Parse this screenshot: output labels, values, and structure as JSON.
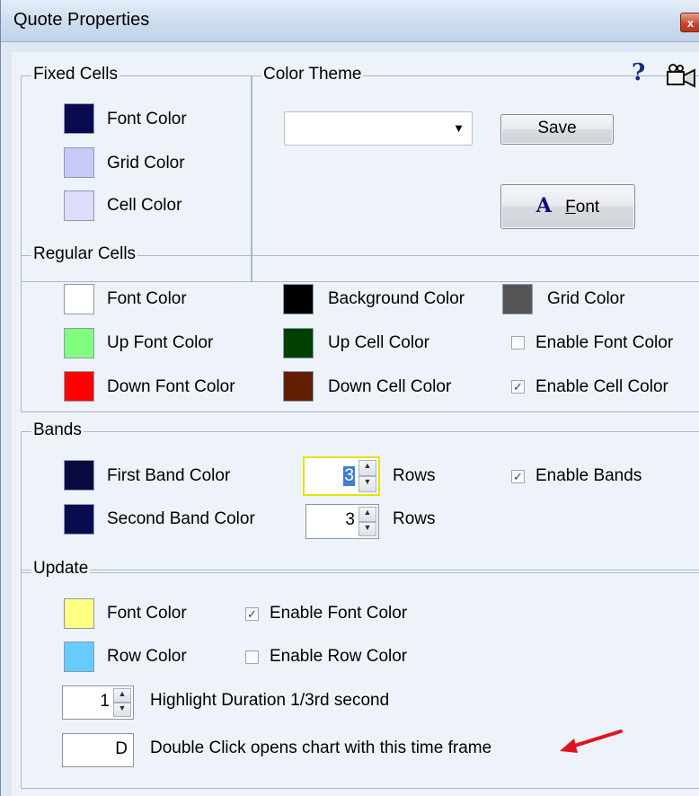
{
  "window": {
    "title": "Quote Properties",
    "close_glyph": "x"
  },
  "fixed_cells": {
    "legend": "Fixed Cells",
    "items": [
      {
        "label": "Font Color",
        "color": "#0a0a50"
      },
      {
        "label": "Grid Color",
        "color": "#c9c9f7"
      },
      {
        "label": "Cell Color",
        "color": "#dcdcfb"
      }
    ]
  },
  "color_theme": {
    "legend": "Color Theme",
    "selected": "",
    "save_label": "Save",
    "font_glyph": "A",
    "font_label": "Font",
    "font_accel": "F"
  },
  "regular_cells": {
    "legend": "Regular Cells",
    "col1": [
      {
        "label": "Font Color",
        "color": "#ffffff"
      },
      {
        "label": "Up Font Color",
        "color": "#80ff80"
      },
      {
        "label": "Down Font Color",
        "color": "#ff0000"
      }
    ],
    "col2": [
      {
        "label": "Background Color",
        "color": "#000000"
      },
      {
        "label": "Up Cell Color",
        "color": "#004000"
      },
      {
        "label": "Down Cell Color",
        "color": "#602000"
      }
    ],
    "grid_color": {
      "label": "Grid Color",
      "color": "#555555"
    },
    "enable_font_color": {
      "label": "Enable Font Color",
      "checked": false
    },
    "enable_cell_color": {
      "label": "Enable Cell Color",
      "checked": true
    }
  },
  "bands": {
    "legend": "Bands",
    "first": {
      "label": "First Band Color",
      "color": "#0a0a40",
      "rows": "3",
      "rows_label": "Rows"
    },
    "second": {
      "label": "Second Band Color",
      "color": "#0a0a50",
      "rows": "3",
      "rows_label": "Rows"
    },
    "enable_bands": {
      "label": "Enable Bands",
      "checked": true
    }
  },
  "update": {
    "legend": "Update",
    "font": {
      "label": "Font Color",
      "color": "#ffff80"
    },
    "row": {
      "label": "Row Color",
      "color": "#66ccff"
    },
    "enable_font_color": {
      "label": "Enable Font Color",
      "checked": true
    },
    "enable_row_color": {
      "label": "Enable Row Color",
      "checked": false
    },
    "highlight": {
      "value": "1",
      "label": "Highlight Duration 1/3rd second"
    },
    "double_click": {
      "value": "D",
      "label": "Double Click opens chart with this time frame"
    }
  },
  "icons": {
    "help": "?",
    "check": "✓",
    "up": "▲",
    "down": "▼",
    "dropdown": "▼"
  }
}
